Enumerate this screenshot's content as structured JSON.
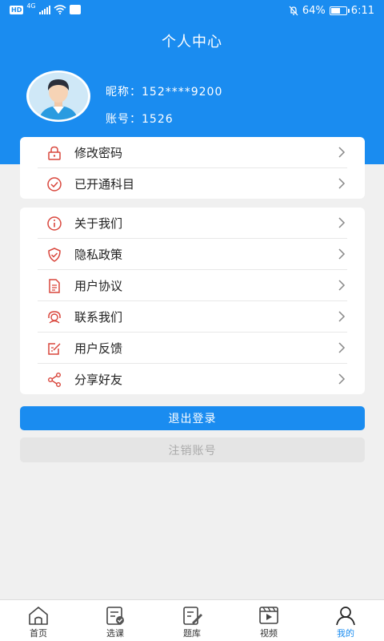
{
  "status": {
    "hd": "HD",
    "network": "4G",
    "battery": "64%",
    "battery_level": 0.64,
    "time": "6:11"
  },
  "header": {
    "title": "个人中心"
  },
  "user": {
    "nickname_label": "昵称：",
    "nickname": "152****9200",
    "account_label": "账号：",
    "account": "1526"
  },
  "menu_group1": [
    {
      "label": "修改密码",
      "icon": "lock-icon"
    },
    {
      "label": "已开通科目",
      "icon": "check-circle-icon"
    }
  ],
  "menu_group2": [
    {
      "label": "关于我们",
      "icon": "info-icon"
    },
    {
      "label": "隐私政策",
      "icon": "shield-icon"
    },
    {
      "label": "用户协议",
      "icon": "document-icon"
    },
    {
      "label": "联系我们",
      "icon": "support-icon"
    },
    {
      "label": "用户反馈",
      "icon": "feedback-icon"
    },
    {
      "label": "分享好友",
      "icon": "share-icon"
    }
  ],
  "buttons": {
    "logout": "退出登录",
    "cancel_account": "注销账号"
  },
  "tabs": [
    {
      "label": "首页",
      "icon": "home-icon"
    },
    {
      "label": "选课",
      "icon": "course-icon"
    },
    {
      "label": "题库",
      "icon": "question-bank-icon"
    },
    {
      "label": "视频",
      "icon": "video-icon"
    },
    {
      "label": "我的",
      "icon": "profile-icon"
    }
  ],
  "colors": {
    "primary": "#1a8cf0",
    "icon_red": "#d9463c",
    "background": "#f0f0f0"
  }
}
